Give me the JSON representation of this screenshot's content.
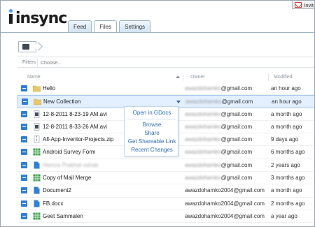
{
  "app": {
    "logo_text": "insync",
    "invite_label": "Invit"
  },
  "tabs": [
    {
      "label": "Feed",
      "active": false
    },
    {
      "label": "Files",
      "active": true
    },
    {
      "label": "Settings",
      "active": false
    }
  ],
  "filters": {
    "label": "Filters",
    "placeholder": "Choose..."
  },
  "columns": {
    "name": "Name",
    "owner": "Owner",
    "modified": "Modified"
  },
  "files": [
    {
      "icon": "folder-icon",
      "name": "Hello",
      "name_blurred": false,
      "owner_prefix": "awazdohamko",
      "owner_suffix": "@gmail.com",
      "modified": "an hour ago",
      "selected": false
    },
    {
      "icon": "folder-icon",
      "name": "New Collection",
      "name_blurred": false,
      "owner_prefix": "awazdohamko",
      "owner_suffix": "@gmail.com",
      "modified": "an hour ago",
      "selected": true
    },
    {
      "icon": "video-file-icon",
      "name": "12-8-2011 8-23-19 AM.avi",
      "name_blurred": false,
      "owner_prefix": "awazdohamko",
      "owner_suffix": "@gmail.com",
      "modified": "a month ago",
      "selected": false
    },
    {
      "icon": "video-file-icon",
      "name": "12-8-2011 8-33-26 AM.avi",
      "name_blurred": false,
      "owner_prefix": "awazdohamko",
      "owner_suffix": "@gmail.com",
      "modified": "a month ago",
      "selected": false
    },
    {
      "icon": "zip-file-icon",
      "name": "All-App-Inventor-Projects.zip",
      "name_blurred": false,
      "owner_prefix": "awazdohamko",
      "owner_suffix": "@gmail.com",
      "modified": "9 days ago",
      "selected": false
    },
    {
      "icon": "spreadsheet-icon",
      "name": "Android Survey Form",
      "name_blurred": false,
      "owner_prefix": "awazdohamko",
      "owner_suffix": "@gmail.com",
      "modified": "6 months ago",
      "selected": false
    },
    {
      "icon": "document-icon",
      "name": "Hamza Prabhat sahab",
      "name_blurred": true,
      "owner_prefix": "awazdohamko",
      "owner_suffix": "@gmail.com",
      "modified": "2 years ago",
      "selected": false
    },
    {
      "icon": "spreadsheet-icon",
      "name": "Copy of Mail Merge",
      "name_blurred": false,
      "owner_prefix": "awazdohamko",
      "owner_suffix": "@gmail.com",
      "modified": "3 months ago",
      "selected": false
    },
    {
      "icon": "document-icon",
      "name": "Document2",
      "name_blurred": false,
      "owner_prefix": "",
      "owner_suffix": "awazdohamko2004@gmail.com",
      "modified": "a month ago",
      "selected": false
    },
    {
      "icon": "document-icon",
      "name": "FB.docx",
      "name_blurred": false,
      "owner_prefix": "",
      "owner_suffix": "awazdohamko2004@gmail.com",
      "modified": "2 months ago",
      "selected": false
    },
    {
      "icon": "spreadsheet-icon",
      "name": "Geet Sammalen",
      "name_blurred": false,
      "owner_prefix": "",
      "owner_suffix": "awazdohamko2004@gmail.com",
      "modified": "a year ago",
      "selected": false
    }
  ],
  "context_menu": {
    "items": [
      "Open in GDocs",
      "Browse",
      "Share",
      "Get Shareable Link",
      "Recent Changes"
    ]
  },
  "colors": {
    "accent": "#2f7fd6",
    "selection": "#e2efff",
    "link": "#2f6fb8",
    "folder": "#e8c86a"
  }
}
